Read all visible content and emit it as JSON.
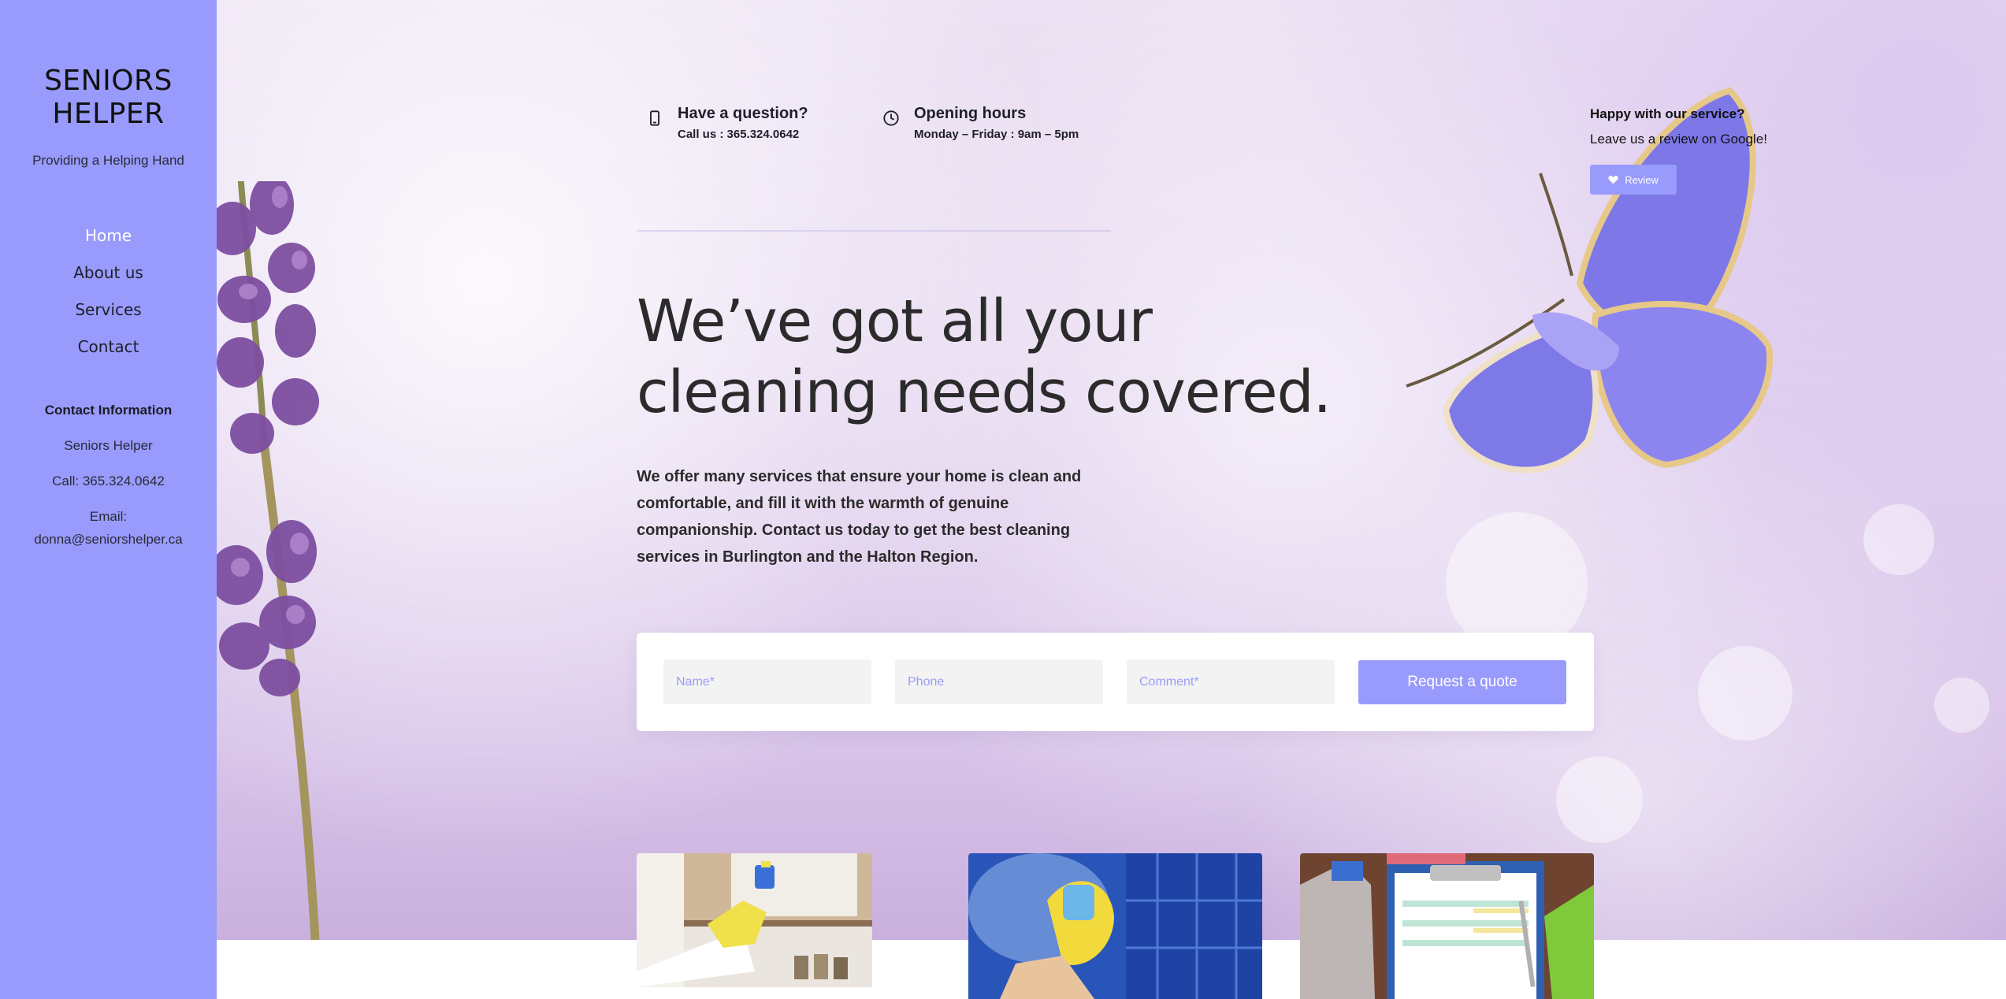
{
  "sidebar": {
    "brand_line1": "SENIORS",
    "brand_line2": "HELPER",
    "tagline": "Providing a Helping Hand",
    "nav": [
      {
        "label": "Home",
        "active": true
      },
      {
        "label": "About us",
        "active": false
      },
      {
        "label": "Services",
        "active": false
      },
      {
        "label": "Contact",
        "active": false
      }
    ],
    "contact": {
      "heading": "Contact Information",
      "name": "Seniors Helper",
      "phone": "Call: 365.324.0642",
      "email_label": "Email:",
      "email": "donna@seniorshelper.ca"
    }
  },
  "header": {
    "question": {
      "title": "Have a question?",
      "detail": "Call us : 365.324.0642",
      "icon": "phone-icon"
    },
    "hours": {
      "title": "Opening hours",
      "detail": "Monday – Friday : 9am – 5pm",
      "icon": "clock-icon"
    },
    "review": {
      "title": "Happy with our service?",
      "text": "Leave us a review on Google!",
      "button_label": "Review",
      "icon": "heart-icon"
    }
  },
  "hero": {
    "headline_line1": "We’ve got all your",
    "headline_line2": "cleaning needs covered.",
    "description": "We offer many services that ensure your home is clean and comfortable, and fill it with the warmth of genuine companionship. Contact us today to get the best cleaning services in Burlington and the Halton Region."
  },
  "quote_form": {
    "name_placeholder": "Name*",
    "phone_placeholder": "Phone",
    "comment_placeholder": "Comment*",
    "submit_label": "Request a quote"
  },
  "colors": {
    "accent": "#989bfb",
    "text": "#2b2b2b"
  }
}
